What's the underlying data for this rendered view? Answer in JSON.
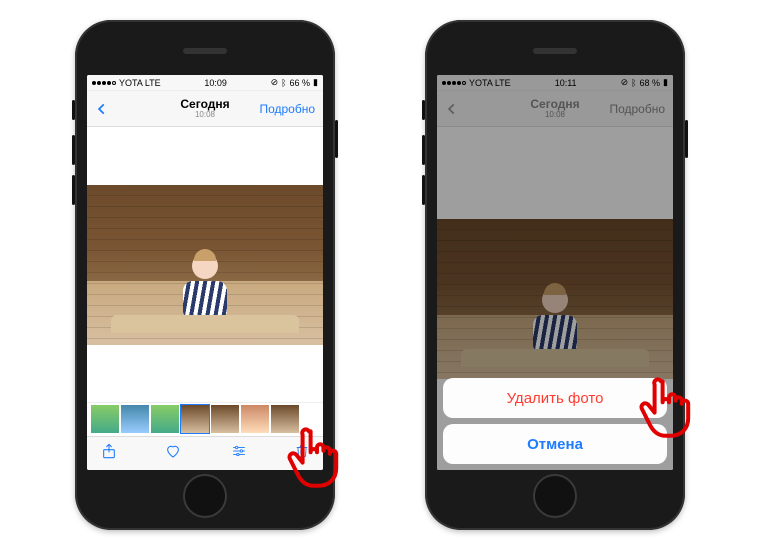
{
  "phone1": {
    "status": {
      "carrier": "YOTA  LTE",
      "time": "10:09",
      "battery": "66 %"
    },
    "nav": {
      "title": "Сегодня",
      "subtitle": "10:08",
      "details": "Подробно"
    },
    "toolbar": {
      "share": "share-icon",
      "favorite": "heart-icon",
      "edit": "sliders-icon",
      "trash": "trash-icon"
    }
  },
  "phone2": {
    "status": {
      "carrier": "YOTA  LTE",
      "time": "10:11",
      "battery": "68 %"
    },
    "nav": {
      "title": "Сегодня",
      "subtitle": "10:08",
      "details": "Подробно"
    },
    "sheet": {
      "delete": "Удалить фото",
      "cancel": "Отмена"
    }
  }
}
